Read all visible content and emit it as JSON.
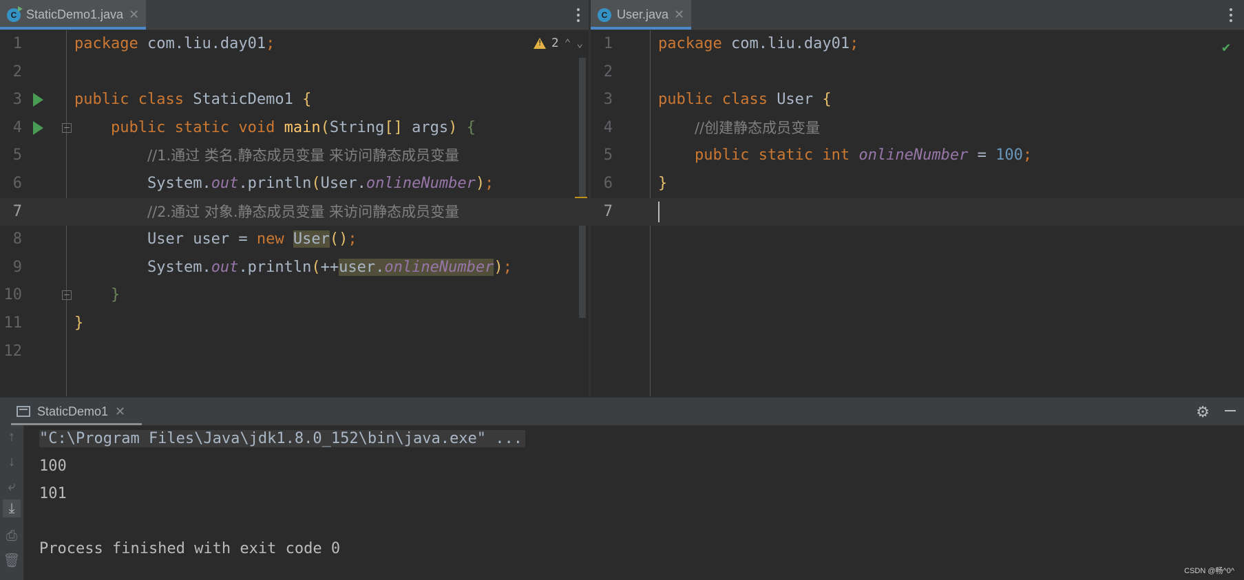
{
  "left_editor": {
    "tab": {
      "label": "StaticDemo1.java",
      "icon": "java-class-run-icon"
    },
    "warnings": {
      "count": "2"
    },
    "lines": [
      {
        "n": "1",
        "parts": [
          [
            "kw",
            "package "
          ],
          [
            "cls",
            "com.liu.day01"
          ],
          [
            "kw",
            ";"
          ]
        ]
      },
      {
        "n": "2",
        "parts": []
      },
      {
        "n": "3",
        "parts": [
          [
            "kw",
            "public class "
          ],
          [
            "cls",
            "StaticDemo1 "
          ],
          [
            "br1",
            "{"
          ]
        ],
        "run": true
      },
      {
        "n": "4",
        "parts": [
          [
            "sp",
            "    "
          ],
          [
            "kw",
            "public static void "
          ],
          [
            "fn",
            "main"
          ],
          [
            "br1",
            "("
          ],
          [
            "cls",
            "String"
          ],
          [
            "br1",
            "[] "
          ],
          [
            "cls",
            "args"
          ],
          [
            "br1",
            ") "
          ],
          [
            "br2",
            "{"
          ]
        ],
        "run": true,
        "fold": true
      },
      {
        "n": "5",
        "parts": [
          [
            "sp",
            "        "
          ],
          [
            "cm",
            "//1.通过 类名.静态成员变量 来访问静态成员变量"
          ]
        ]
      },
      {
        "n": "6",
        "parts": [
          [
            "sp",
            "        "
          ],
          [
            "cls",
            "System."
          ],
          [
            "fld",
            "out"
          ],
          [
            "cls",
            ".println"
          ],
          [
            "br1",
            "("
          ],
          [
            "cls",
            "User."
          ],
          [
            "fld",
            "onlineNumber"
          ],
          [
            "br1",
            ")"
          ],
          [
            "kw",
            ";"
          ]
        ]
      },
      {
        "n": "7",
        "parts": [
          [
            "sp",
            "        "
          ],
          [
            "cm",
            "//2.通过 对象.静态成员变量 来访问静态成员变量"
          ]
        ],
        "current": true
      },
      {
        "n": "8",
        "parts": [
          [
            "sp",
            "        "
          ],
          [
            "cls",
            "User user = "
          ],
          [
            "kw",
            "new "
          ],
          [
            "hl2",
            "User"
          ],
          [
            "br1",
            "()"
          ],
          [
            "kw",
            ";"
          ]
        ]
      },
      {
        "n": "9",
        "parts": [
          [
            "sp",
            "        "
          ],
          [
            "cls",
            "System."
          ],
          [
            "fld",
            "out"
          ],
          [
            "cls",
            ".println"
          ],
          [
            "br1",
            "("
          ],
          [
            "cls",
            "++"
          ],
          [
            "hlc",
            "user."
          ],
          [
            "hlf",
            "onlineNumber"
          ],
          [
            "br1",
            ")"
          ],
          [
            "kw",
            ";"
          ]
        ]
      },
      {
        "n": "10",
        "parts": [
          [
            "sp",
            "    "
          ],
          [
            "br2",
            "}"
          ]
        ],
        "fold": true
      },
      {
        "n": "11",
        "parts": [
          [
            "br1",
            "}"
          ]
        ]
      },
      {
        "n": "12",
        "parts": []
      }
    ]
  },
  "right_editor": {
    "tab": {
      "label": "User.java",
      "icon": "java-class-icon"
    },
    "lines": [
      {
        "n": "1",
        "parts": [
          [
            "kw",
            "package "
          ],
          [
            "cls",
            "com.liu.day01"
          ],
          [
            "kw",
            ";"
          ]
        ]
      },
      {
        "n": "2",
        "parts": []
      },
      {
        "n": "3",
        "parts": [
          [
            "kw",
            "public class "
          ],
          [
            "cls",
            "User "
          ],
          [
            "br1",
            "{"
          ]
        ]
      },
      {
        "n": "4",
        "parts": [
          [
            "sp",
            "    "
          ],
          [
            "cm",
            "//创建静态成员变量"
          ]
        ]
      },
      {
        "n": "5",
        "parts": [
          [
            "sp",
            "    "
          ],
          [
            "kw",
            "public static int "
          ],
          [
            "fld",
            "onlineNumber"
          ],
          [
            "cls",
            " = "
          ],
          [
            "num",
            "100"
          ],
          [
            "kw",
            ";"
          ]
        ]
      },
      {
        "n": "6",
        "parts": [
          [
            "br1",
            "}"
          ]
        ]
      },
      {
        "n": "7",
        "parts": [],
        "current": true
      }
    ]
  },
  "run_panel": {
    "tab_label": "StaticDemo1",
    "console": {
      "command": "\"C:\\Program Files\\Java\\jdk1.8.0_152\\bin\\java.exe\" ...",
      "output_1": "100",
      "output_2": "101",
      "exit": "Process finished with exit code 0"
    }
  },
  "watermark": "CSDN @畅^0^",
  "colors": {
    "accent": "#4a88c7",
    "keyword": "#cc7832",
    "field": "#9876aa",
    "comment": "#808080",
    "number": "#6897bb",
    "function": "#ffc66d"
  }
}
